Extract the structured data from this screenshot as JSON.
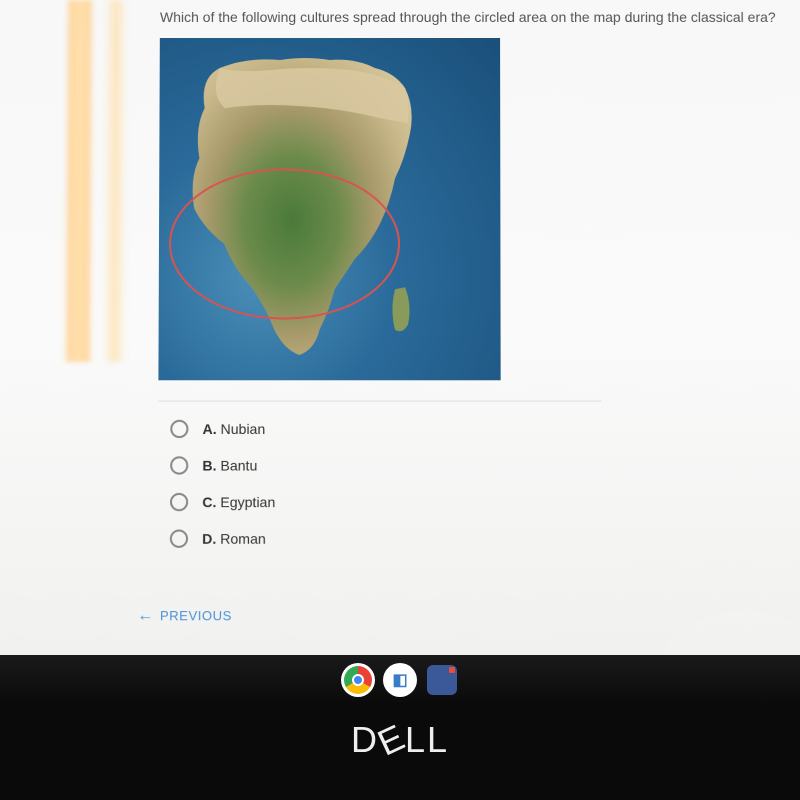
{
  "question": {
    "text": "Which of the following cultures spread through the circled area on the map during the classical era?"
  },
  "map": {
    "region": "Africa",
    "circled_area": "Central-West Africa / Sub-Saharan belt"
  },
  "options": [
    {
      "letter": "A.",
      "text": "Nubian"
    },
    {
      "letter": "B.",
      "text": "Bantu"
    },
    {
      "letter": "C.",
      "text": "Egyptian"
    },
    {
      "letter": "D.",
      "text": "Roman"
    }
  ],
  "navigation": {
    "previous_label": "PREVIOUS"
  },
  "taskbar": {
    "icons": [
      "chrome",
      "app",
      "blue-app"
    ]
  },
  "device": {
    "brand": "DELL"
  }
}
